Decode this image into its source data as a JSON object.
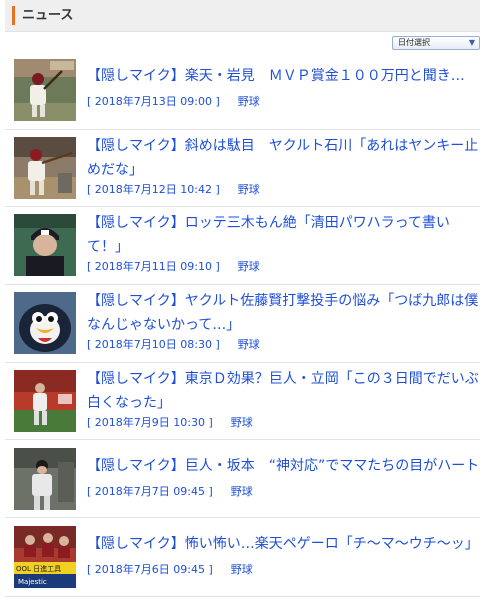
{
  "header": {
    "title": "ニュース"
  },
  "sort": {
    "label": "日付選択"
  },
  "news": [
    {
      "title": "【隠しマイク】楽天・岩見　ＭＶＰ賞金１００万円と聞き…",
      "date": "[ 2018年7月13日 09:00 ]",
      "category": "野球",
      "thumb_icon": "rakuten-batter-photo"
    },
    {
      "title": "【隠しマイク】斜めは駄目　ヤクルト石川「あれはヤンキー止めだな」",
      "date": "[ 2018年7月12日 10:42 ]",
      "category": "野球",
      "thumb_icon": "swinging-batter-photo"
    },
    {
      "title": "【隠しマイク】ロッテ三木もん絶「清田パワハラって書いて！」",
      "date": "[ 2018年7月11日 09:10 ]",
      "category": "野球",
      "thumb_icon": "marines-player-photo"
    },
    {
      "title": "【隠しマイク】ヤクルト佐藤賢打撃投手の悩み「つば九郎は僕なんじゃないかって…」",
      "date": "[ 2018年7月10日 08:30 ]",
      "category": "野球",
      "thumb_icon": "tsubakuro-mascot-photo"
    },
    {
      "title": "【隠しマイク】東京Ｄ効果？巨人・立岡「この３日間でだいぶ白くなった」",
      "date": "[ 2018年7月9日 10:30 ]",
      "category": "野球",
      "thumb_icon": "fielder-photo"
    },
    {
      "title": "【隠しマイク】巨人・坂本　“神対応”でママたちの目がハート",
      "date": "[ 2018年7月7日 09:45 ]",
      "category": "野球",
      "thumb_icon": "giants-player-photo"
    },
    {
      "title": "【隠しマイク】怖い怖い…楽天ペゲーロ「チ～マ～ウチ～ッ」",
      "date": "[ 2018年7月6日 09:45 ]",
      "category": "野球",
      "thumb_icon": "dugout-ad-photo",
      "ad_text_1": "OOL 日進工具",
      "ad_text_2": "Majestic"
    }
  ]
}
